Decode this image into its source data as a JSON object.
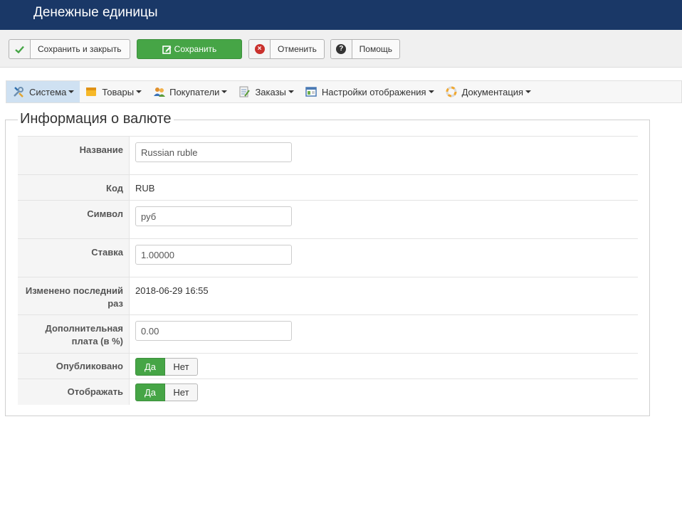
{
  "header": {
    "title": "Денежные единицы"
  },
  "toolbar": {
    "save_close_label": "Сохранить и закрыть",
    "save_label": "Сохранить",
    "cancel_label": "Отменить",
    "help_label": "Помощь"
  },
  "menu": {
    "items": [
      {
        "label": "Система",
        "icon": "tools-icon"
      },
      {
        "label": "Товары",
        "icon": "box-icon"
      },
      {
        "label": "Покупатели",
        "icon": "users-icon"
      },
      {
        "label": "Заказы",
        "icon": "orders-icon"
      },
      {
        "label": "Настройки отображения",
        "icon": "display-icon"
      },
      {
        "label": "Документация",
        "icon": "lifebuoy-icon"
      }
    ]
  },
  "form": {
    "legend": "Информация о валюте",
    "name_label": "Название",
    "name_value": "Russian ruble",
    "code_label": "Код",
    "code_value": "RUB",
    "symbol_label": "Символ",
    "symbol_value": "руб",
    "rate_label": "Ставка",
    "rate_value": "1.00000",
    "modified_label": "Изменено последний раз",
    "modified_value": "2018-06-29 16:55",
    "fee_label": "Дополнительная плата (в %)",
    "fee_value": "0.00",
    "published_label": "Опубликовано",
    "display_label": "Отображать",
    "yes_label": "Да",
    "no_label": "Нет"
  },
  "colors": {
    "header_bg": "#1a3867",
    "success": "#46a546",
    "menu_active": "#cfe1f2"
  }
}
